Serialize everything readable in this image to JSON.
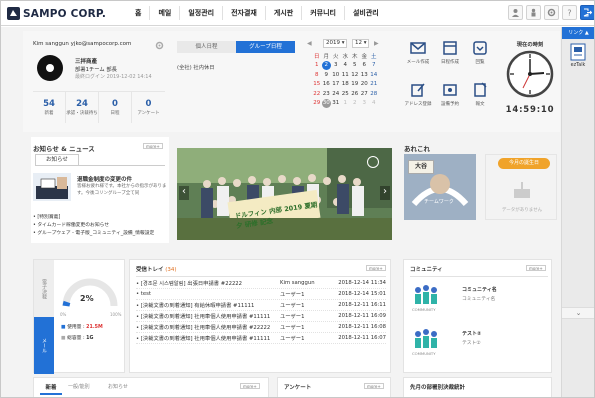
{
  "brand": {
    "name": "SAMPO CORP."
  },
  "nav": {
    "items": [
      "홈",
      "메일",
      "일정관리",
      "전자결재",
      "게시판",
      "커뮤니티",
      "설비관리"
    ]
  },
  "profile": {
    "header": "Kim sanggun yjko@sampocorp.com",
    "company": "三拌商產",
    "dept": "部署1チーム 部長",
    "last_login": "最終ログイン 2019-12-02 14:14",
    "stats": [
      {
        "value": "54",
        "label": "新着"
      },
      {
        "value": "24",
        "label": "承認・決裁待ち"
      },
      {
        "value": "0",
        "label": "日程"
      },
      {
        "value": "0",
        "label": "アンケート"
      }
    ]
  },
  "schedule": {
    "tabs": [
      "個人日程",
      "グループ日程"
    ],
    "entry": "(全社) 社内休日"
  },
  "calendar": {
    "year": "2019",
    "month": "12",
    "weekdays": [
      "日",
      "月",
      "火",
      "水",
      "木",
      "金",
      "土"
    ],
    "weeks": [
      [
        "1",
        "2",
        "3",
        "4",
        "5",
        "6",
        "7"
      ],
      [
        "8",
        "9",
        "10",
        "11",
        "12",
        "13",
        "14"
      ],
      [
        "15",
        "16",
        "17",
        "18",
        "19",
        "20",
        "21"
      ],
      [
        "22",
        "23",
        "24",
        "25",
        "26",
        "27",
        "28"
      ],
      [
        "29",
        "30",
        "31",
        "1",
        "2",
        "3",
        "4"
      ]
    ]
  },
  "quick": {
    "items": [
      "メール作成",
      "日程作成",
      "回覧",
      "アドレス登録",
      "設備予約",
      "報文"
    ]
  },
  "clock": {
    "title": "現在の時刻",
    "time": "14:59:10"
  },
  "news": {
    "title": "お知らせ & ニュース",
    "more": "more+",
    "tab": "お知らせ",
    "headline": "退職金制度の変更の件",
    "body": "皆様お疲れ様です。本社からの指示があります。今後コリングループ全て同",
    "items": [
      "[特別賞義]",
      "タイムカード稼働変更のお知らせ",
      "グループウェア - 電子版_コミュニティ_設備_情報設定"
    ]
  },
  "photo": {
    "banner": "ドルフィン 内部 2019 夏期 夕 研修 記念",
    "prev": "‹",
    "next": "›"
  },
  "misc": {
    "title": "あれこれ",
    "card1": "チームワーク",
    "card2_badge": "今月の誕生日",
    "card2_text": "データがありません",
    "sign_main": "大谷",
    "sign_top": "ホーム"
  },
  "mailbox": {
    "label1": "電子決裁",
    "label2": "メール",
    "percent": "2%",
    "scale_min": "0%",
    "scale_max": "100%",
    "used_label": "使用量 :",
    "used_value": "21.5M",
    "total_label": "総容量 :",
    "total_value": "1G"
  },
  "inbox": {
    "title": "受信トレイ",
    "count": "(34)",
    "more": "more+",
    "rows": [
      {
        "subject": "[경조문 시스템알림] 出張日申請書 #22222",
        "sender": "Kim sanggun",
        "date": "2018-12-14 11:34"
      },
      {
        "subject": "test",
        "sender": "ユーザー1",
        "date": "2018-12-14 15:01"
      },
      {
        "subject": "[決裁文書の到着通知] 有給休暇申請書 #11111",
        "sender": "ユーザー1",
        "date": "2018-12-11 16:11"
      },
      {
        "subject": "[決裁文書の到着通知] 社用車個人使用申請書 #11111",
        "sender": "ユーザー1",
        "date": "2018-12-11 16:09"
      },
      {
        "subject": "[決裁文書の到着通知] 社用車個人使用申請書 #22222",
        "sender": "ユーザー1",
        "date": "2018-12-11 16:08"
      },
      {
        "subject": "[決裁文書の到着通知] 社用車個人使用申請書 #11111",
        "sender": "ユーザー1",
        "date": "2018-12-11 16:07"
      }
    ]
  },
  "community": {
    "title": "コミュニティ",
    "more": "more+",
    "items": [
      {
        "name": "コミュニティ名",
        "sub": "コミュニティ名",
        "caption": "COMMUNITY"
      },
      {
        "name": "テスト②",
        "sub": "テスト②",
        "caption": "COMMUNITY"
      }
    ]
  },
  "bottom": {
    "tabs": [
      "新着",
      "一般/能別",
      "お知らせ"
    ],
    "more": "more+",
    "survey": "アンケート",
    "survey_more": "more+",
    "stats": "先月の部署別決裁統計"
  },
  "side": {
    "link": "リンク ▲",
    "app": "ezTalk",
    "down": "⌄"
  }
}
